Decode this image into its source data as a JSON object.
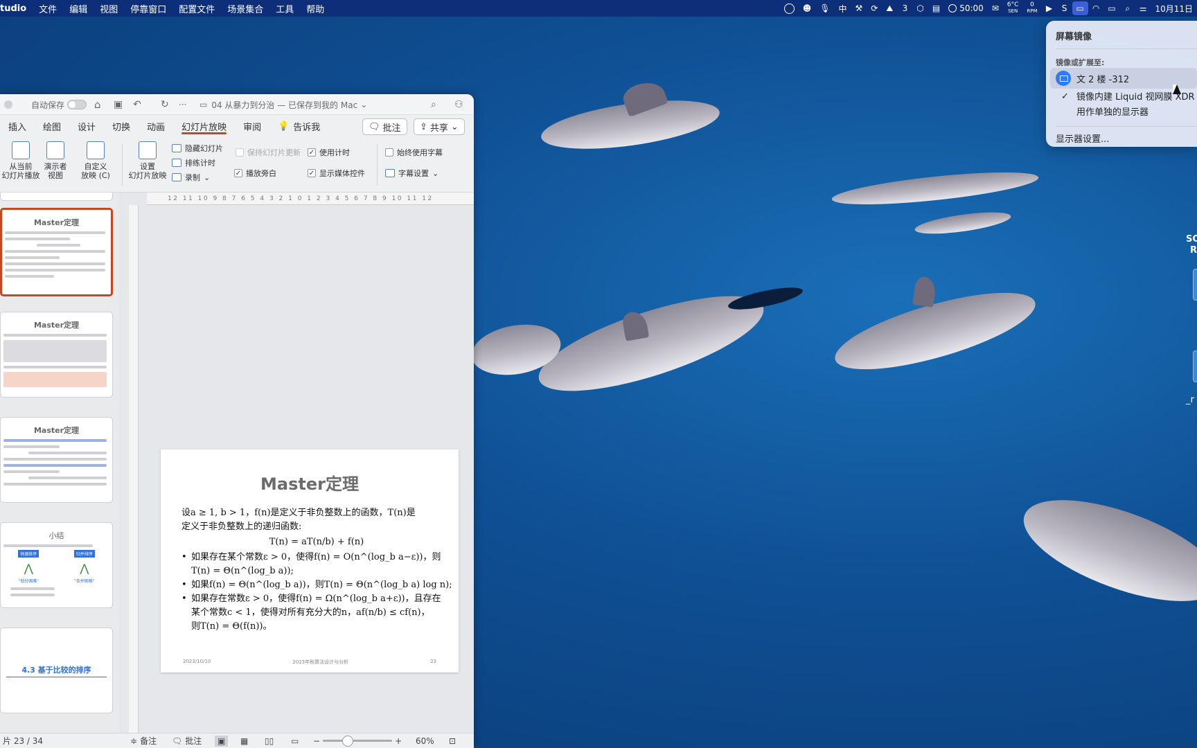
{
  "menubar": {
    "app": "tudio",
    "items": [
      "文件",
      "编辑",
      "视图",
      "停靠窗口",
      "配置文件",
      "场景集合",
      "工具",
      "帮助"
    ],
    "status": {
      "badge_count": "3",
      "timer": "50:00",
      "temp": "6°C",
      "temp_sub": "SEN",
      "rpm_value": "0",
      "rpm_label": "RPM",
      "clock": "10月11日"
    }
  },
  "window": {
    "autosave_label": "自动保存",
    "doc_title": "04 从暴力到分治 — 已保存到我的 Mac",
    "tabs": [
      "插入",
      "绘图",
      "设计",
      "切换",
      "动画",
      "幻灯片放映",
      "审阅",
      "告诉我"
    ],
    "active_tab": "幻灯片放映",
    "comment_button": "批注",
    "share_button": "共享",
    "ribbon": {
      "from_current": [
        "从当前",
        "幻灯片播放"
      ],
      "presenter": [
        "演示者",
        "视图"
      ],
      "custom": [
        "自定义",
        "放映 (C)"
      ],
      "setup": [
        "设置",
        "幻灯片放映"
      ],
      "hide_slide": "隐藏幻灯片",
      "rehearse": "排练计时",
      "record": "录制",
      "keep_updated": "保持幻灯片更新",
      "use_timings": "使用计时",
      "play_narration": "播放旁白",
      "show_media": "显示媒体控件",
      "always_subtitles": "始终使用字幕",
      "subtitle_settings": "字幕设置"
    },
    "ruler_ticks": "12 11 10 9 8 7 6 5 4 3 2 1 0 1 2 3 4 5 6 7 8 9 10 11 12",
    "thumbnails": [
      {
        "title": "Master定理"
      },
      {
        "title": "Master定理"
      },
      {
        "title": "Master定理"
      },
      {
        "title": "小结",
        "left_tag": "快速排序",
        "right_tag": "归并排序",
        "left_q": "\"划分困难\"",
        "right_q": "\"合并困难\""
      },
      {
        "title": "4.3 基于比较的排序"
      }
    ],
    "slide": {
      "title": "Master定理",
      "intro_1": "设a ≥ 1, b > 1，f(n)是定义于非负整数上的函数，T(n)是",
      "intro_2": "定义于非负整数上的递归函数:",
      "formula": "T(n) = aT(n/b) + f(n)",
      "case1_a": "如果存在某个常数ε > 0，使得f(n) = O(n^(log_b a−ε))，则",
      "case1_b": "T(n) = Θ(n^(log_b a));",
      "case2": "如果f(n) = Θ(n^(log_b a))，则T(n) = Θ(n^(log_b a) log n);",
      "case3_a": "如果存在常数ε > 0，使得f(n) = Ω(n^(log_b a+ε))，且存在",
      "case3_b": "某个常数c < 1，使得对所有充分大的n，af(n/b) ≤ cf(n)，",
      "case3_c": "则T(n) = Θ(f(n))。",
      "footer_date": "2023/10/10",
      "footer_course": "2023年秋算法设计与分析",
      "footer_page": "23"
    },
    "status": {
      "slide_counter": "片 23 / 34",
      "notes": "备注",
      "comments": "批注",
      "zoom": "60%"
    }
  },
  "control_center": {
    "title": "屏幕镜像",
    "section": "镜像或扩展至:",
    "device": "文 2 楼 -312",
    "option_1": "镜像内建 Liquid 视网膜 XDR 显",
    "option_2": "用作单独的显示器",
    "settings": "显示器设置..."
  },
  "desktop": {
    "side_label_1": "SC",
    "side_label_2": "R",
    "side_label_3": "_r"
  }
}
